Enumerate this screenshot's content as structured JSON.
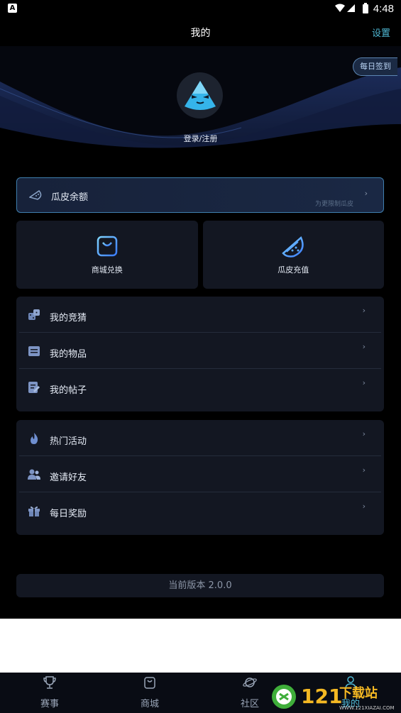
{
  "status_bar": {
    "time": "4:48",
    "left_icon": "A"
  },
  "header": {
    "title": "我的",
    "settings_label": "设置"
  },
  "hero": {
    "checkin_label": "每日签到",
    "login_label": "登录/注册"
  },
  "balance": {
    "label": "瓜皮余额",
    "note": "为更限制瓜皮",
    "chevron": "›"
  },
  "quick_actions": [
    {
      "label": "商城兑换",
      "icon": "shopping-bag-icon"
    },
    {
      "label": "瓜皮充值",
      "icon": "watermelon-icon"
    }
  ],
  "menu_group_1": [
    {
      "label": "我的竞猜",
      "icon": "dice-icon"
    },
    {
      "label": "我的物品",
      "icon": "box-list-icon"
    },
    {
      "label": "我的帖子",
      "icon": "post-edit-icon"
    }
  ],
  "menu_group_2": [
    {
      "label": "热门活动",
      "icon": "fire-icon"
    },
    {
      "label": "邀请好友",
      "icon": "friends-icon"
    },
    {
      "label": "每日奖励",
      "icon": "gift-icon"
    }
  ],
  "version": "当前版本 2.0.0",
  "tabbar": [
    {
      "label": "赛事",
      "icon": "trophy-icon"
    },
    {
      "label": "商城",
      "icon": "bag-icon"
    },
    {
      "label": "社区",
      "icon": "planet-icon"
    },
    {
      "label": "我的",
      "icon": "user-icon"
    }
  ],
  "watermark": {
    "text": "121下载站",
    "subtext": "WWW.121XIAZAI.COM"
  },
  "colors": {
    "accent": "#4fb8d4",
    "panel": "#131722",
    "background": "#000000",
    "balance_border": "#3f7fae"
  }
}
